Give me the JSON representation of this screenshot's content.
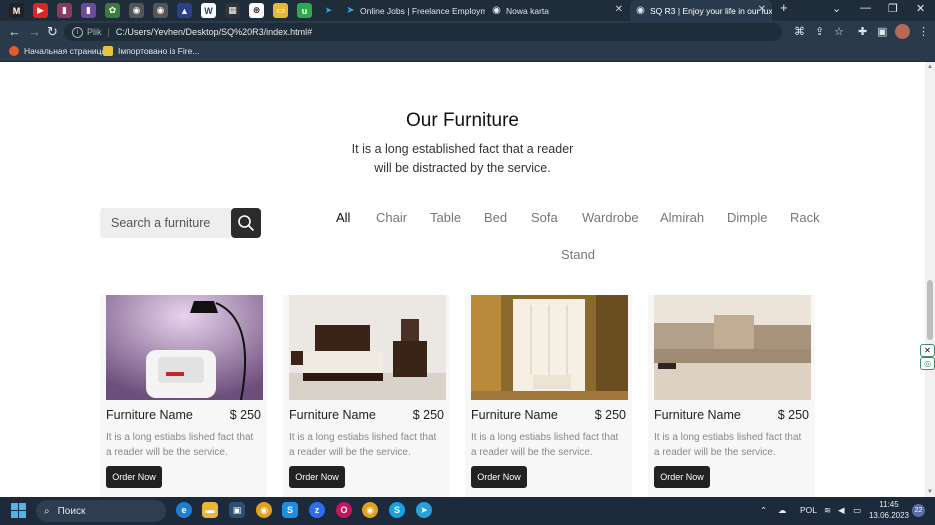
{
  "browser": {
    "tabs": [
      {
        "title": "Online Jobs | Freelance Employm"
      },
      {
        "title": "Nowa karta"
      },
      {
        "title": "SQ R3 | Enjoy your life in our lux"
      }
    ],
    "new_tab_label": "+",
    "address": {
      "scheme": "Plik",
      "url": "C:/Users/Yevhen/Desktop/SQ%20R3/index.html#"
    },
    "bookmarks": [
      {
        "label": "Начальная страница"
      },
      {
        "label": "Імпортовано із Fire..."
      }
    ]
  },
  "section": {
    "title": "Our Furniture",
    "subtitle_line1": "It is a long established fact that a reader",
    "subtitle_line2": "will be distracted by the service."
  },
  "search": {
    "placeholder": "Search a furniture"
  },
  "filters": [
    "All",
    "Chair",
    "Table",
    "Bed",
    "Sofa",
    "Wardrobe",
    "Almirah",
    "Dimple",
    "Rack",
    "Stand"
  ],
  "active_filter": "All",
  "products": [
    {
      "name": "Furniture Name",
      "price": "$ 250",
      "desc": "It is a long estiabs lished fact that a reader will be the service.",
      "button": "Order Now",
      "image": "armchair-lamp"
    },
    {
      "name": "Furniture Name",
      "price": "$ 250",
      "desc": "It is a long estiabs lished fact that a reader will be the service.",
      "button": "Order Now",
      "image": "bed"
    },
    {
      "name": "Furniture Name",
      "price": "$ 250",
      "desc": "It is a long estiabs lished fact that a reader will be the service.",
      "button": "Order Now",
      "image": "wardrobe"
    },
    {
      "name": "Furniture Name",
      "price": "$ 250",
      "desc": "It is a long estiabs lished fact that a reader will be the service.",
      "button": "Order Now",
      "image": "sofa"
    }
  ],
  "taskbar": {
    "search_label": "Поиск",
    "language": "POL",
    "time": "11:45",
    "date": "13.06.2023",
    "notification_count": "22"
  }
}
